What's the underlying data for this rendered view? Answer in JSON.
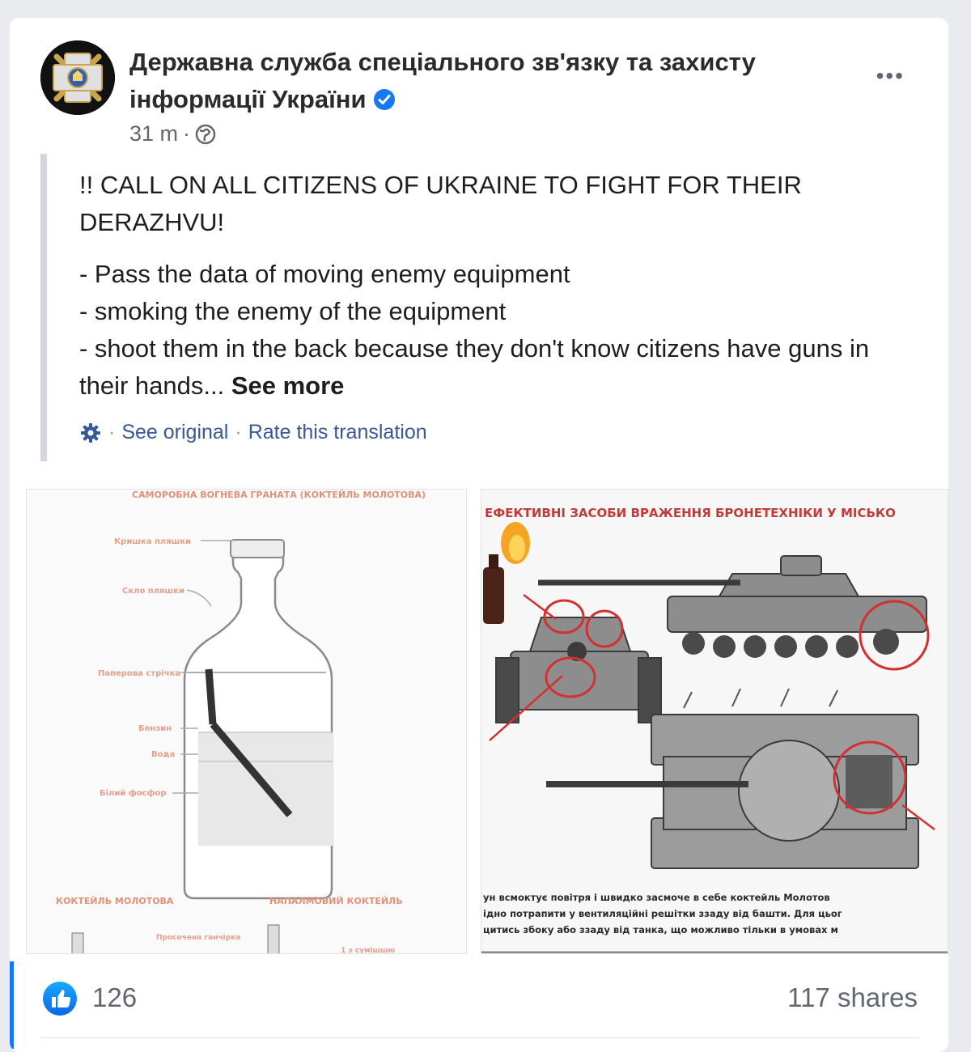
{
  "post": {
    "page_name": "Державна служба спеціального зв'язку та захисту інформації України",
    "time": "31 m",
    "separator": "·",
    "more_label": "•••",
    "headline": "!!  CALL ON ALL CITIZENS OF UKRAINE TO FIGHT FOR THEIR DERAZHVU!",
    "lines": [
      "- Pass the data of moving enemy equipment",
      "- smoking the enemy of the equipment",
      "- shoot them in the back because they don't know citizens have guns in their hands..."
    ],
    "see_more": "See more",
    "see_original": "See original",
    "rate_translation": "Rate this translation",
    "dot": "·"
  },
  "images": {
    "left": {
      "top_title": "САМОРОБНА ВОГНЕВА ГРАНАТА (КОКТЕЙЛЬ МОЛОТОВА)",
      "labels": [
        "Кришка пляшки",
        "Скло пляшки",
        "Паперова стрічка",
        "Бензин",
        "Вода",
        "Білий фосфор"
      ],
      "bottom_left": "КОКТЕЙЛЬ МОЛОТОВА",
      "bottom_right": "НАПАЛМОВИЙ КОКТЕЙЛЬ",
      "small_1": "Просочена ганчірка",
      "small_2": "1 з сумішшю"
    },
    "right": {
      "title": "ЕФЕКТИВНІ ЗАСОБИ ВРАЖЕННЯ БРОНЕТЕХНІКИ У МІСЬКО",
      "caption_lines": [
        "ун всмоктує повітря і швидко засмоче в себе коктейль Молотов",
        "ідно потрапити у вентиляційні решітки ззаду від башти. Для цьог",
        "цитись збоку або ззаду від танка, що можливо тільки в умовах м"
      ]
    }
  },
  "footer": {
    "like_count": "126",
    "shares": "117 shares"
  },
  "colors": {
    "link": "#385898",
    "verified": "#1877f2",
    "annotation_red": "#d33030"
  }
}
